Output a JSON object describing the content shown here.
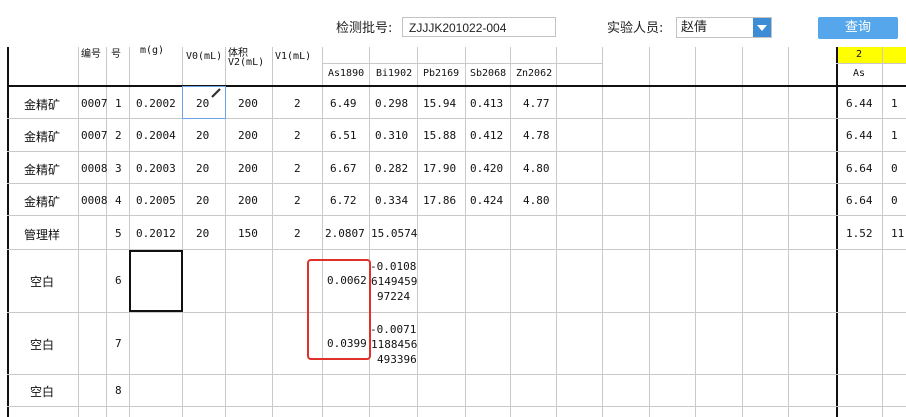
{
  "toolbar": {
    "batch_label": "检测批号:",
    "batch_value": "ZJJJK201022-004",
    "person_label": "实验人员:",
    "person_value": "赵倩",
    "query_label": "查询"
  },
  "header": {
    "col_number_partial": "编号",
    "col_seq_partial": "号",
    "col_mass_partial": "m(g)",
    "col_v0": "V0(mL)",
    "col_v2_top": "体积",
    "col_v2": "V2(mL)",
    "col_v1": "V1(mL)",
    "elements": [
      "As1890",
      "Bi1902",
      "Pb2169",
      "Sb2068",
      "Zn2062"
    ],
    "right_group_top": "2",
    "right_group_el": "As"
  },
  "rows": [
    {
      "type": "金精矿",
      "num": "0007",
      "seq": "1",
      "mass": "0.2002",
      "v0": "20",
      "v2": "200",
      "v1": "2",
      "as": "6.49",
      "bi": "0.298",
      "pb": "15.94",
      "sb": "0.413",
      "zn": "4.77",
      "r1": "6.44",
      "r2": "1"
    },
    {
      "type": "金精矿",
      "num": "0007",
      "seq": "2",
      "mass": "0.2004",
      "v0": "20",
      "v2": "200",
      "v1": "2",
      "as": "6.51",
      "bi": "0.310",
      "pb": "15.88",
      "sb": "0.412",
      "zn": "4.78",
      "r1": "6.44",
      "r2": "1"
    },
    {
      "type": "金精矿",
      "num": "0008",
      "seq": "3",
      "mass": "0.2003",
      "v0": "20",
      "v2": "200",
      "v1": "2",
      "as": "6.67",
      "bi": "0.282",
      "pb": "17.90",
      "sb": "0.420",
      "zn": "4.80",
      "r1": "6.64",
      "r2": "0"
    },
    {
      "type": "金精矿",
      "num": "0008",
      "seq": "4",
      "mass": "0.2005",
      "v0": "20",
      "v2": "200",
      "v1": "2",
      "as": "6.72",
      "bi": "0.334",
      "pb": "17.86",
      "sb": "0.424",
      "zn": "4.80",
      "r1": "6.64",
      "r2": "0"
    },
    {
      "type": "管理样",
      "num": "",
      "seq": "5",
      "mass": "0.2012",
      "v0": "20",
      "v2": "150",
      "v1": "2",
      "as": "2.0807",
      "bi": "15.0574",
      "pb": "",
      "sb": "",
      "zn": "",
      "r1": "1.52",
      "r2": "11."
    },
    {
      "type": "空白",
      "num": "",
      "seq": "6",
      "mass": "",
      "v0": "",
      "v2": "",
      "v1": "",
      "as": "0.0062",
      "bi_lines": [
        "-0.0108",
        "6149459",
        "97224"
      ],
      "r1": "",
      "r2": ""
    },
    {
      "type": "空白",
      "num": "",
      "seq": "7",
      "mass": "",
      "v0": "",
      "v2": "",
      "v1": "",
      "as": "0.0399",
      "bi_lines": [
        "-0.0071",
        "1188456",
        "493396"
      ],
      "r1": "",
      "r2": ""
    },
    {
      "type": "空白",
      "num": "",
      "seq": "8"
    }
  ],
  "colors": {
    "query_button": "#55a6ea",
    "dropdown_button": "#3c8dd6",
    "highlight_red": "#e0302a",
    "header_yellow": "#ffff00",
    "active_cell_border": "#6aa6e6"
  }
}
